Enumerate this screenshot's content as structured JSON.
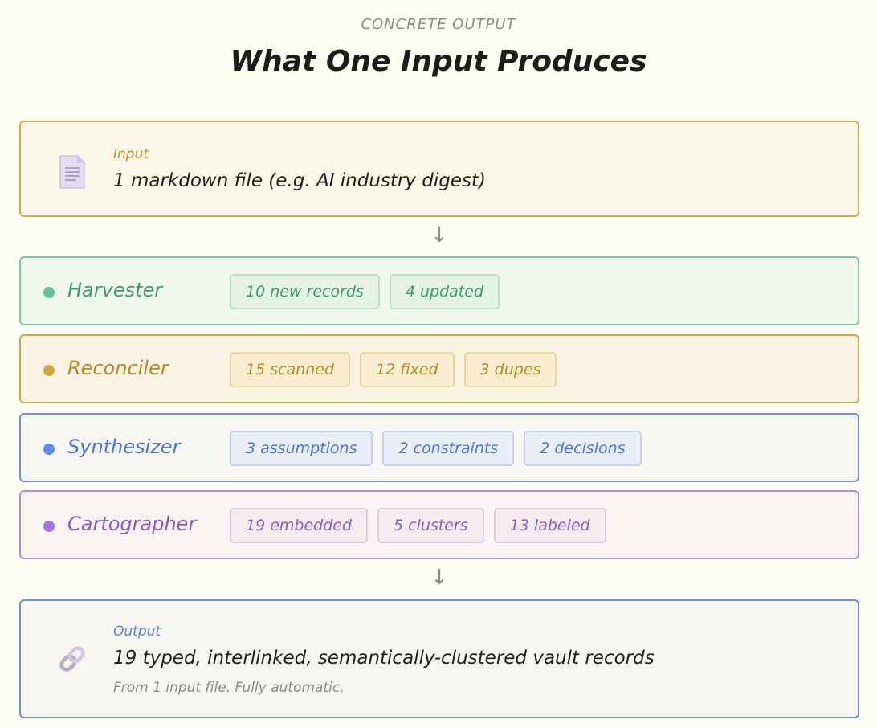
{
  "header": {
    "eyebrow": "CONCRETE OUTPUT",
    "title": "What One Input Produces"
  },
  "input": {
    "icon": "document-icon",
    "label": "Input",
    "text": "1 markdown file (e.g. AI industry digest)"
  },
  "arrows": [
    "↓",
    "↓"
  ],
  "stages": [
    {
      "name": "Harvester",
      "color": "#67c296",
      "chips": [
        "10 new records",
        "4 updated"
      ]
    },
    {
      "name": "Reconciler",
      "color": "#d2a640",
      "chips": [
        "15 scanned",
        "12 fixed",
        "3 dupes"
      ]
    },
    {
      "name": "Synthesizer",
      "color": "#5f8cf0",
      "chips": [
        "3 assumptions",
        "2 constraints",
        "2 decisions"
      ]
    },
    {
      "name": "Cartographer",
      "color": "#a374df",
      "chips": [
        "19 embedded",
        "5 clusters",
        "13 labeled"
      ]
    }
  ],
  "output": {
    "icon": "link-icon",
    "label": "Output",
    "text": "19 typed, interlinked, semantically-clustered vault records",
    "subtext": "From 1 input file. Fully automatic."
  }
}
